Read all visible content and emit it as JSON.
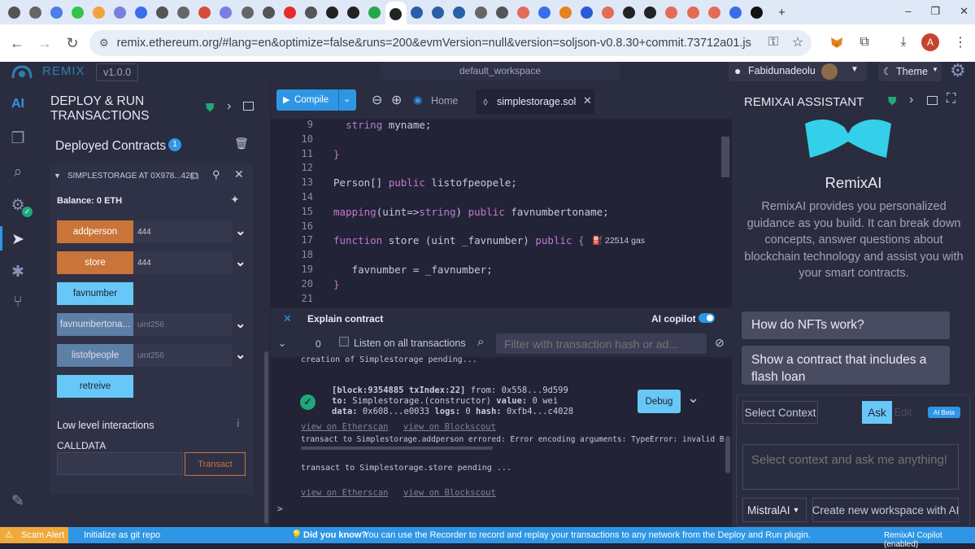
{
  "browser": {
    "active_tab_index": 18,
    "tabs": [
      {
        "icon": "chevron-down-icon",
        "color": "#555"
      },
      {
        "icon": "chrome-icon",
        "color": "#666"
      },
      {
        "icon": "docs-icon",
        "color": "#4a7ee8"
      },
      {
        "icon": "whatsapp-icon",
        "color": "#35c24b"
      },
      {
        "icon": "cloud-icon",
        "color": "#f2a33b"
      },
      {
        "icon": "shield-icon",
        "color": "#7a7ee0"
      },
      {
        "icon": "messenger-icon",
        "color": "#3a6ee8"
      },
      {
        "icon": "google-icon",
        "color": "#555"
      },
      {
        "icon": "chrome-icon",
        "color": "#666"
      },
      {
        "icon": "gmail-icon",
        "color": "#d94a3d"
      },
      {
        "icon": "shield-icon",
        "color": "#7a7ee0"
      },
      {
        "icon": "chrome-icon",
        "color": "#666"
      },
      {
        "icon": "google-icon",
        "color": "#555"
      },
      {
        "icon": "youtube-icon",
        "color": "#e52d27"
      },
      {
        "icon": "google-icon",
        "color": "#555"
      },
      {
        "icon": "github-icon",
        "color": "#222"
      },
      {
        "icon": "github-icon",
        "color": "#222"
      },
      {
        "icon": "play-icon",
        "color": "#23a848"
      },
      {
        "icon": "openai-icon",
        "color": "#222"
      },
      {
        "icon": "remix-icon",
        "color": "#2b5ea8"
      },
      {
        "icon": "remix-icon",
        "color": "#2b5ea8"
      },
      {
        "icon": "remix-icon",
        "color": "#2b5ea8"
      },
      {
        "icon": "puzzle-icon",
        "color": "#666"
      },
      {
        "icon": "google-icon",
        "color": "#555"
      },
      {
        "icon": "rainbow-icon",
        "color": "#e36b57"
      },
      {
        "icon": "download-icon",
        "color": "#3a6ee8"
      },
      {
        "icon": "metamask-icon",
        "color": "#e8821e"
      },
      {
        "icon": "hexagon-icon",
        "color": "#2a5ada"
      },
      {
        "icon": "rainbow-icon",
        "color": "#e36b57"
      },
      {
        "icon": "github-icon",
        "color": "#222"
      },
      {
        "icon": "openai-icon",
        "color": "#222"
      },
      {
        "icon": "rainbow-icon",
        "color": "#e36b57"
      },
      {
        "icon": "rainbow-icon",
        "color": "#e36b57"
      },
      {
        "icon": "rainbow-icon",
        "color": "#e36b57"
      },
      {
        "icon": "puzzle-icon",
        "color": "#3a6ee8"
      },
      {
        "icon": "x-icon",
        "color": "#111"
      }
    ],
    "new_tab_glyph": "+",
    "window_controls": [
      "–",
      "❐",
      "✕"
    ],
    "url": "remix.ethereum.org/#lang=en&optimize=false&runs=200&evmVersion=null&version=soljson-v0.8.30+commit.73712a01.js",
    "avatar_letter": "A"
  },
  "header": {
    "logo": "REMIX",
    "version": "v1.0.0",
    "workspace": "default_workspace",
    "github_user": "Fabidunadeolu",
    "theme_label": "Theme"
  },
  "deploy": {
    "title_line1": "DEPLOY & RUN",
    "title_line2": "TRANSACTIONS",
    "deployed_title": "Deployed Contracts",
    "deployed_count": "1",
    "instance_name": "SIMPLESTORAGE AT 0X978...42(",
    "balance": "Balance: 0 ETH",
    "functions": [
      {
        "label": "addperson",
        "style": "orange",
        "arg": "444",
        "expand": true
      },
      {
        "label": "store",
        "style": "orange",
        "arg": "444",
        "expand": true
      },
      {
        "label": "favnumber",
        "style": "blue",
        "arg": "",
        "expand": false
      },
      {
        "label": "favnumbertona...",
        "style": "steel",
        "arg": "uint256",
        "expand": true
      },
      {
        "label": "listofpeople",
        "style": "steel",
        "arg": "uint256",
        "expand": true
      },
      {
        "label": "retreive",
        "style": "blue",
        "arg": "",
        "expand": false
      }
    ],
    "low_level": "Low level interactions",
    "calldata": "CALLDATA",
    "transact": "Transact"
  },
  "editor": {
    "compile": "Compile",
    "home_tab": "Home",
    "file_tab": "simplestorage.sol",
    "lines": [
      {
        "n": "9",
        "code": [
          {
            "t": "  "
          },
          {
            "t": "string",
            "c": "ty"
          },
          {
            "t": " myname;"
          }
        ]
      },
      {
        "n": "10",
        "code": []
      },
      {
        "n": "11",
        "code": [
          {
            "t": "}",
            "c": "kw"
          }
        ]
      },
      {
        "n": "12",
        "code": []
      },
      {
        "n": "13",
        "code": [
          {
            "t": "Person[] "
          },
          {
            "t": "public",
            "c": "kw"
          },
          {
            "t": " listofpeopele;"
          }
        ]
      },
      {
        "n": "14",
        "code": []
      },
      {
        "n": "15",
        "code": [
          {
            "t": "mapping",
            "c": "kw"
          },
          {
            "t": "(uint=>"
          },
          {
            "t": "string",
            "c": "ty"
          },
          {
            "t": ") "
          },
          {
            "t": "public",
            "c": "kw"
          },
          {
            "t": " favnumbertoname;"
          }
        ]
      },
      {
        "n": "16",
        "code": []
      },
      {
        "n": "17",
        "code": [
          {
            "t": "function",
            "c": "kw"
          },
          {
            "t": " store (uint _favnumber) "
          },
          {
            "t": "public",
            "c": "kw"
          },
          {
            "t": " {",
            "c": "kw"
          }
        ]
      },
      {
        "n": "18",
        "code": []
      },
      {
        "n": "19",
        "code": [
          {
            "t": "   favnumber = _favnumber;"
          }
        ]
      },
      {
        "n": "20",
        "code": [
          {
            "t": "}",
            "c": "kw"
          }
        ]
      },
      {
        "n": "21",
        "code": []
      }
    ],
    "gas_hint": "22514 gas",
    "explain": "Explain contract",
    "ai_copilot": "AI copilot"
  },
  "terminal": {
    "count": "0",
    "listen": "Listen on all transactions",
    "filter_placeholder": "Filter with transaction hash or ad...",
    "pending1": "creation of Simplestorage pending...",
    "tx_line1_a": "[block:9354885 txIndex:22]",
    "tx_line1_b": " from: 0x558...9d599",
    "tx_line2_a": "to:",
    "tx_line2_b": " Simplestorage.(constructor) ",
    "tx_line2_c": "value:",
    "tx_line2_d": " 0 wei",
    "tx_line3_a": "data:",
    "tx_line3_b": " 0x608...e0033 ",
    "tx_line3_c": "logs:",
    "tx_line3_d": " 0 ",
    "tx_line3_e": "hash:",
    "tx_line3_f": " 0xfb4...c4028",
    "debug": "Debug",
    "etherscan": "view on Etherscan",
    "blockscout": "view on Blockscout",
    "error": "transact to Simplestorage.addperson errored: Error encoding arguments: TypeError: invalid B",
    "pending2": "transact to Simplestorage.store pending ...",
    "prompt": ">"
  },
  "ai": {
    "title": "REMIXAI ASSISTANT",
    "name": "RemixAI",
    "desc": "RemixAI provides you personalized guidance as you build. It can break down concepts, answer questions about blockchain technology and assist you with your smart contracts.",
    "suggestion1": "How do NFTs work?",
    "suggestion2": "Show a contract that includes a flash loan",
    "select_context": "Select Context",
    "ask": "Ask",
    "edit": "Edit",
    "badge": "AI Beta",
    "input_placeholder": "Select context and ask me anything!",
    "model": "MistralAI",
    "create_ws": "Create new workspace with AI"
  },
  "status": {
    "scam": "Scam Alert",
    "git": "Initialize as git repo",
    "did_you_know": "Did you know?",
    "tip": "You can use the Recorder to record and replay your transactions to any network from the Deploy and Run plugin.",
    "copilot": "RemixAI Copilot (enabled)"
  }
}
